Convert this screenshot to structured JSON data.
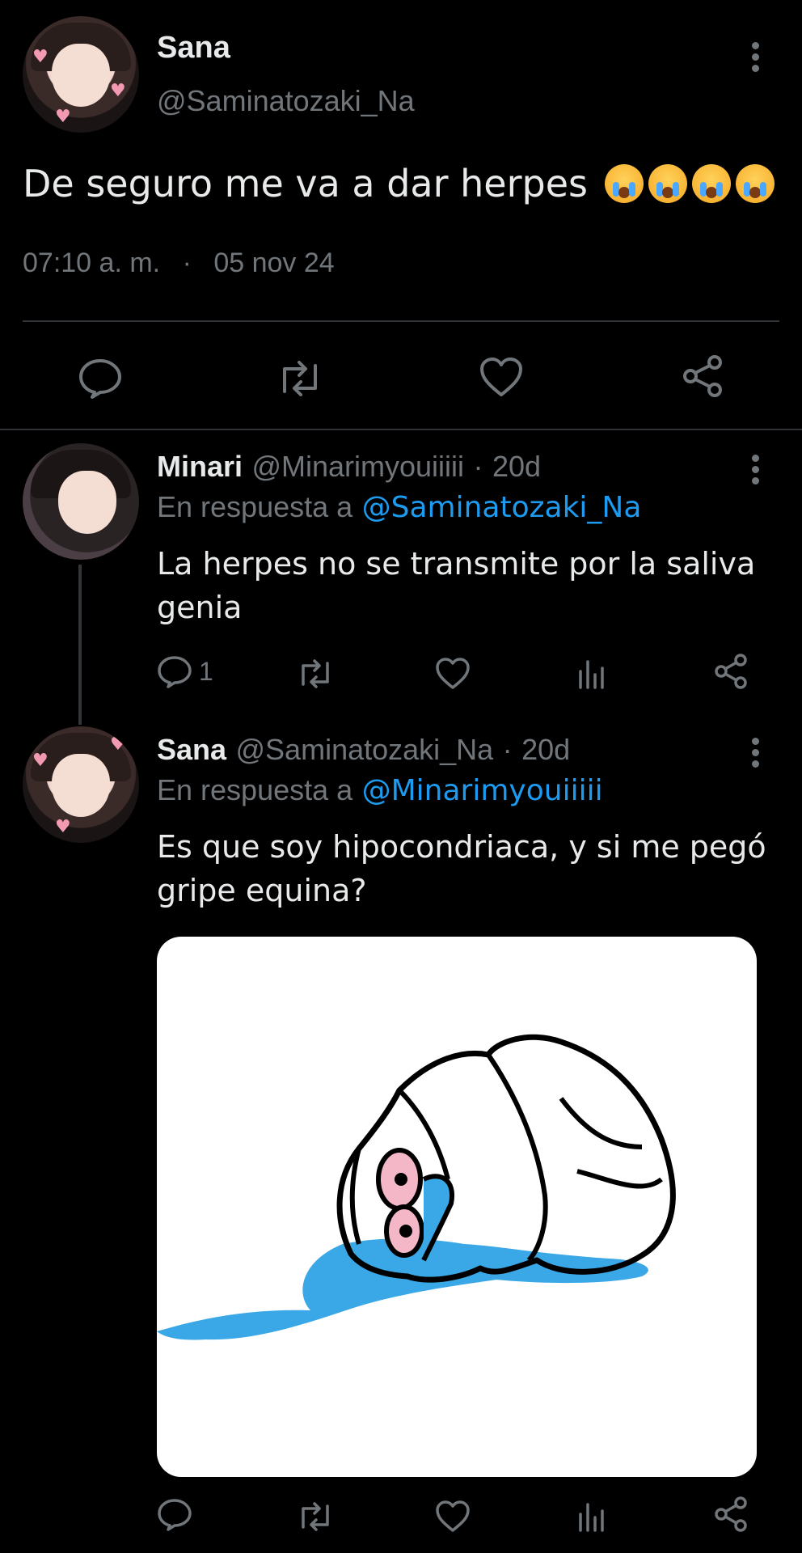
{
  "main_tweet": {
    "name": "Sana",
    "handle": "@Saminatozaki_Na",
    "text": "De seguro me va a dar herpes",
    "emoji_count": 4,
    "time": "07:10 a. m.",
    "separator": "·",
    "date": "05 nov 24"
  },
  "replies": [
    {
      "name": "Minari",
      "handle": "@Minarimyouiiiii",
      "dot": "·",
      "age": "20d",
      "reply_prefix": "En respuesta a",
      "reply_to": "@Saminatozaki_Na",
      "text_line1": "La herpes no se transmite por la saliva",
      "text_line2": "genia",
      "reply_count": "1"
    },
    {
      "name": "Sana",
      "handle": "@Saminatozaki_Na",
      "dot": "·",
      "age": "20d",
      "reply_prefix": "En respuesta a",
      "reply_to": "@Minarimyouiiiii",
      "text_line1": "Es que soy hipocondriaca, y si me pegó",
      "text_line2": "gripe equina?",
      "media": "crying-wojak-drawing"
    }
  ],
  "colors": {
    "background": "#000000",
    "text": "#e7e9ea",
    "muted": "#71767b",
    "link": "#1d9bf0",
    "tears": "#3aa7e6"
  }
}
